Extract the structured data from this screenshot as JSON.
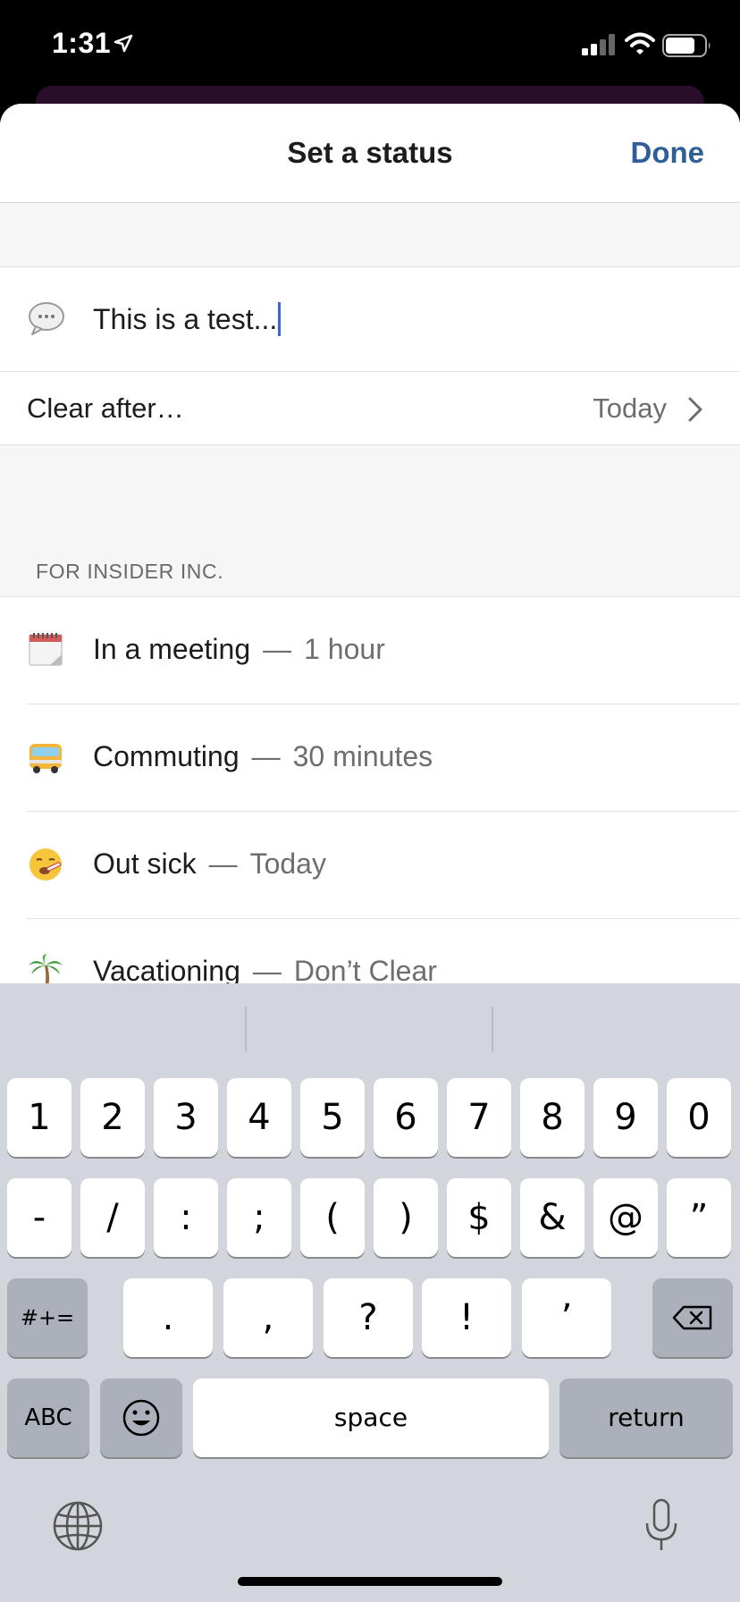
{
  "status_bar": {
    "time": "1:31"
  },
  "sheet": {
    "title": "Set a status",
    "done_label": "Done",
    "status_input": {
      "value": "This is a test..."
    },
    "clear_after": {
      "label": "Clear after…",
      "value": "Today"
    },
    "section_header": "FOR INSIDER INC.",
    "presets": [
      {
        "emoji": "calendar-icon",
        "label": "In a meeting",
        "dash": "—",
        "duration": "1 hour"
      },
      {
        "emoji": "bus-icon",
        "label": "Commuting",
        "dash": "—",
        "duration": "30 minutes"
      },
      {
        "emoji": "sick-face-icon",
        "label": "Out sick",
        "dash": "—",
        "duration": "Today"
      },
      {
        "emoji": "palm-tree-icon",
        "label": "Vacationing",
        "dash": "—",
        "duration": "Don’t Clear"
      }
    ]
  },
  "keyboard": {
    "row1": [
      "1",
      "2",
      "3",
      "4",
      "5",
      "6",
      "7",
      "8",
      "9",
      "0"
    ],
    "row2": [
      "-",
      "/",
      ":",
      ";",
      "(",
      ")",
      "$",
      "&",
      "@",
      "”"
    ],
    "row3": [
      ".",
      ",",
      "?",
      "!",
      "’"
    ],
    "mode_symbols": "#+=",
    "mode_abc": "ABC",
    "space": "space",
    "return": "return"
  },
  "colors": {
    "done": "#2f5f99",
    "caret": "#3e63d6",
    "keyboard_bg": "#d3d5dc"
  }
}
